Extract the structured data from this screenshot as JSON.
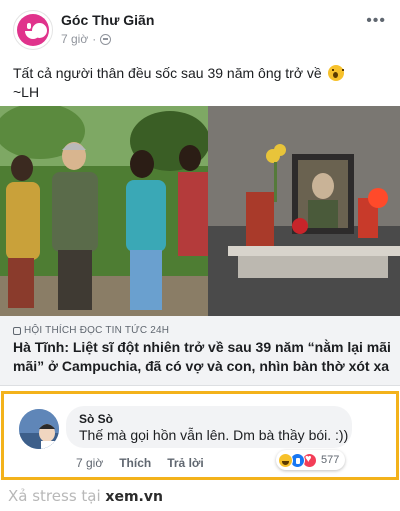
{
  "post": {
    "page_name": "Góc Thư Giãn",
    "time": "7 giờ",
    "privacy_icon": "globe-icon",
    "more_icon": "more-options-icon",
    "text_line1": "Tất cả người thân đều sốc sau 39 năm ông trở về",
    "text_emoji": "wow-emoji",
    "text_line2": "~LH"
  },
  "link": {
    "source": "HỘI THÍCH ĐỌC TIN TỨC 24H",
    "title": "Hà Tĩnh: Liệt sĩ đột nhiên trở về sau 39 năm “nằm lại mãi mãi” ở Campuchia, đã có vợ và con, nhìn bàn thờ xót xa"
  },
  "comment": {
    "author": "Sò Sò",
    "text": "Thế mà gọi hồn vẫn lên. Dm bà thầy bói. :))",
    "time": "7 giờ",
    "like_label": "Thích",
    "reply_label": "Trả lời",
    "reactions": [
      "haha",
      "like",
      "love"
    ],
    "reaction_count": "577"
  },
  "footer": {
    "watermark_text": "Xả stress tại",
    "watermark_site": "xem.vn"
  },
  "colors": {
    "highlight_border": "#f3b21b",
    "page_avatar": "#e0338c",
    "link_card_bg": "#f2f3f5"
  }
}
